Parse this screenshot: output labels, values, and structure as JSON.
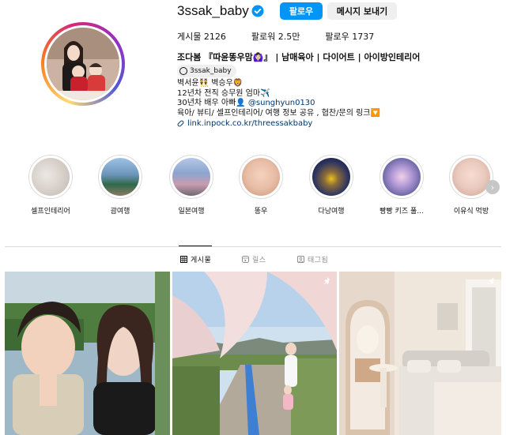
{
  "profile": {
    "username": "3ssak_baby",
    "follow_label": "팔로우",
    "message_label": "메시지 보내기",
    "stats": {
      "posts": "게시물 2126",
      "followers": "팔로워 2.5만",
      "following": "팔로우 1737"
    },
    "full_name": "조다봄 『따윤똥우맘🙆🏻‍♀️』 | 남매육아 | 다이어트 | 아이방인테리어",
    "threads_handle": "3ssak_baby",
    "bio_lines": [
      "벽서윤👯 벽승우🦁",
      "12년차 전직 승무원 엄마✈️",
      "육아/ 뷰티/ 셀프인테리어/ 여행 정보 공유 , 협찬/문의 링크🔽"
    ],
    "bio_line3_prefix": "30년차 배우 아빠👤",
    "bio_mention": "@sunghyun0130",
    "link": "link.inpock.co.kr/threessakbaby"
  },
  "highlights": [
    {
      "label": "셀프인테리어",
      "color": "#d8d2cc"
    },
    {
      "label": "괌여행",
      "color": "#6c93b8"
    },
    {
      "label": "일본여행",
      "color": "#8ba5cf"
    },
    {
      "label": "똥우",
      "color": "#e8bda6"
    },
    {
      "label": "다낭여행",
      "color": "#2d3560"
    },
    {
      "label": "빵빵 키즈 풀...",
      "color": "#6f6aa8"
    },
    {
      "label": "이유식 먹방",
      "color": "#e9c9bd"
    }
  ],
  "tabs": [
    {
      "label": "게시물",
      "icon": "grid-icon",
      "active": true
    },
    {
      "label": "릴스",
      "icon": "reels-icon",
      "active": false
    },
    {
      "label": "태그됨",
      "icon": "tagged-icon",
      "active": false
    }
  ],
  "posts": [
    {
      "subject": "couple-selfie",
      "pinned": false
    },
    {
      "subject": "cherry-blossom-path",
      "pinned": true
    },
    {
      "subject": "bedroom-interior",
      "pinned": true
    }
  ],
  "colors": {
    "accent": "#0095f6",
    "link": "#00376b",
    "muted": "#8e8e8e"
  }
}
